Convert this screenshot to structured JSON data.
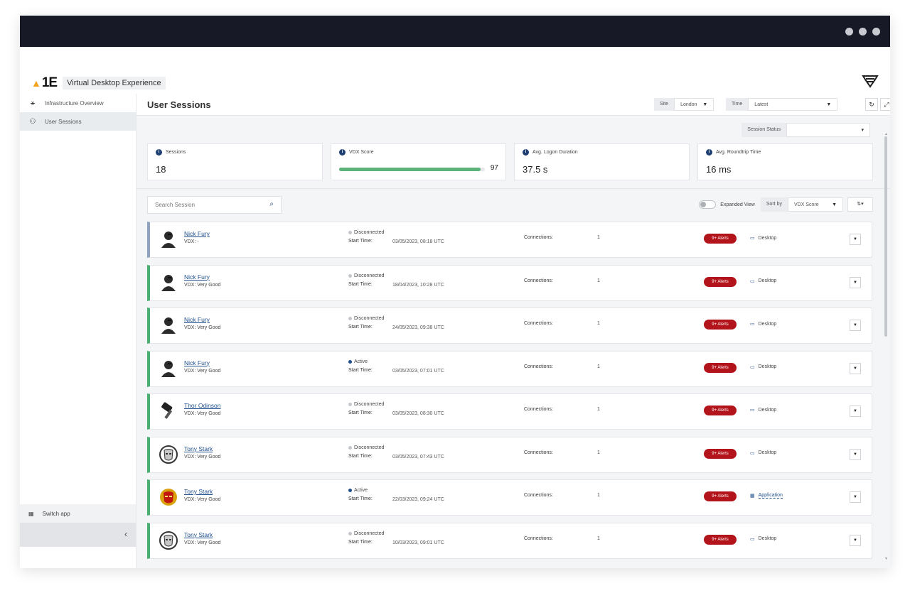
{
  "app": {
    "name": "Virtual Desktop Experience"
  },
  "sidebar": {
    "items": [
      {
        "label": "Infrastructure Overview",
        "icon": "network-icon"
      },
      {
        "label": "User Sessions",
        "icon": "users-icon"
      }
    ],
    "switch_app": "Switch app",
    "collapse": "‹"
  },
  "header": {
    "title": "User Sessions",
    "site_label": "Site",
    "site_value": "London",
    "time_label": "Time",
    "time_value": "Latest"
  },
  "filter": {
    "session_status_label": "Session Status",
    "session_status_value": ""
  },
  "kpis": {
    "sessions": {
      "label": "Sessions",
      "value": "18"
    },
    "vdx": {
      "label": "VDX Score",
      "value": "97",
      "fill_fraction": 0.97
    },
    "logon": {
      "label": "Avg. Logon Duration",
      "value": "37.5 s"
    },
    "roundtrip": {
      "label": "Avg. Roundtrip Time",
      "value": "16 ms"
    }
  },
  "search": {
    "placeholder": "Search Session"
  },
  "list_controls": {
    "expanded_view": "Expanded View",
    "sort_label": "Sort by",
    "sort_value": "VDX Score"
  },
  "labels": {
    "start_time": "Start Time:",
    "connections": "Connections:"
  },
  "sessions": [
    {
      "name": "Nick Fury",
      "vdx": "VDX: -",
      "status": "Disconnected",
      "start": "03/05/2023, 08:18 UTC",
      "connections": "1",
      "alerts": "9+ Alerts",
      "type": "Desktop"
    },
    {
      "name": "Nick Fury",
      "vdx": "VDX: Very Good",
      "status": "Disconnected",
      "start": "18/04/2023, 10:28 UTC",
      "connections": "1",
      "alerts": "9+ Alerts",
      "type": "Desktop"
    },
    {
      "name": "Nick Fury",
      "vdx": "VDX: Very Good",
      "status": "Disconnected",
      "start": "24/05/2023, 09:38 UTC",
      "connections": "1",
      "alerts": "9+ Alerts",
      "type": "Desktop"
    },
    {
      "name": "Nick Fury",
      "vdx": "VDX: Very Good",
      "status": "Active",
      "start": "03/05/2023, 07:01 UTC",
      "connections": "1",
      "alerts": "9+ Alerts",
      "type": "Desktop"
    },
    {
      "name": "Thor Odinson",
      "vdx": "VDX: Very Good",
      "status": "Disconnected",
      "start": "03/05/2023, 08:30 UTC",
      "connections": "1",
      "alerts": "9+ Alerts",
      "type": "Desktop"
    },
    {
      "name": "Tony Stark",
      "vdx": "VDX: Very Good",
      "status": "Disconnected",
      "start": "03/05/2023, 07:43 UTC",
      "connections": "1",
      "alerts": "9+ Alerts",
      "type": "Desktop"
    },
    {
      "name": "Tony Stark",
      "vdx": "VDX: Very Good",
      "status": "Active",
      "start": "22/03/2023, 09:24 UTC",
      "connections": "1",
      "alerts": "9+ Alerts",
      "type": "Application"
    },
    {
      "name": "Tony Stark",
      "vdx": "VDX: Very Good",
      "status": "Disconnected",
      "start": "10/03/2023, 09:01 UTC",
      "connections": "1",
      "alerts": "9+ Alerts",
      "type": "Desktop"
    }
  ]
}
